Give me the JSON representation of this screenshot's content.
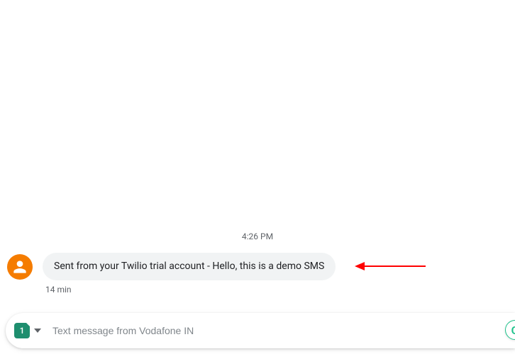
{
  "chat": {
    "timestamp": "4:26 PM",
    "message": {
      "text": "Sent from your Twilio trial account - Hello, this is a demo SMS",
      "age": "14 min"
    }
  },
  "compose": {
    "sim_number": "1",
    "placeholder": "Text message from Vodafone IN"
  },
  "right_badge": {
    "glyph": "G"
  }
}
